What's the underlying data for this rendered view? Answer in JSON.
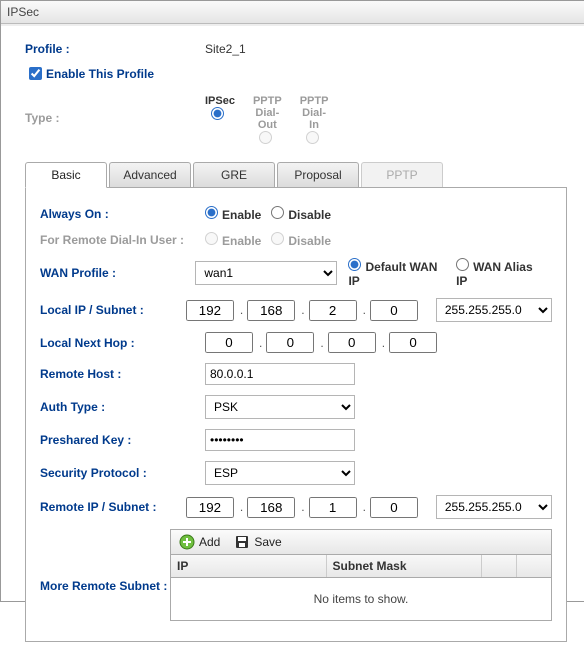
{
  "window": {
    "title": "IPSec"
  },
  "profile": {
    "label": "Profile :",
    "value": "Site2_1",
    "enable_label": "Enable This Profile",
    "enable_checked": true
  },
  "type": {
    "label": "Type :",
    "options": [
      {
        "name": "ipsec",
        "label": "IPSec",
        "checked": true,
        "enabled": true
      },
      {
        "name": "pptp-out",
        "label": "PPTP Dial-Out",
        "checked": false,
        "enabled": false
      },
      {
        "name": "pptp-in",
        "label": "PPTP Dial-In",
        "checked": false,
        "enabled": false
      }
    ]
  },
  "tabs": {
    "items": [
      {
        "id": "basic",
        "label": "Basic",
        "active": true
      },
      {
        "id": "advanced",
        "label": "Advanced",
        "active": false
      },
      {
        "id": "gre",
        "label": "GRE",
        "active": false
      },
      {
        "id": "proposal",
        "label": "Proposal",
        "active": false
      },
      {
        "id": "pptp",
        "label": "PPTP",
        "active": false,
        "disabled": true
      }
    ]
  },
  "basic": {
    "always_on": {
      "label": "Always On :",
      "enable_label": "Enable",
      "disable_label": "Disable",
      "value": "enable"
    },
    "remote_dialin": {
      "label": "For Remote Dial-In User :",
      "enable_label": "Enable",
      "disable_label": "Disable"
    },
    "wan_profile": {
      "label": "WAN Profile :",
      "value": "wan1",
      "default_label": "Default WAN IP",
      "alias_label": "WAN Alias IP",
      "mode": "default"
    },
    "local_ip": {
      "label": "Local IP / Subnet :",
      "o1": "192",
      "o2": "168",
      "o3": "2",
      "o4": "0",
      "mask": "255.255.255.0"
    },
    "next_hop": {
      "label": "Local Next Hop :",
      "o1": "0",
      "o2": "0",
      "o3": "0",
      "o4": "0"
    },
    "remote_host": {
      "label": "Remote Host :",
      "value": "80.0.0.1"
    },
    "auth_type": {
      "label": "Auth Type :",
      "value": "PSK"
    },
    "psk": {
      "label": "Preshared Key :",
      "value": "••••••••"
    },
    "sec_proto": {
      "label": "Security Protocol :",
      "value": "ESP"
    },
    "remote_ip": {
      "label": "Remote IP / Subnet :",
      "o1": "192",
      "o2": "168",
      "o3": "1",
      "o4": "0",
      "mask": "255.255.255.0"
    },
    "more_remote": {
      "label": "More Remote Subnet :",
      "add_label": "Add",
      "save_label": "Save",
      "col_ip": "IP",
      "col_mask": "Subnet Mask",
      "empty": "No items to show."
    }
  }
}
